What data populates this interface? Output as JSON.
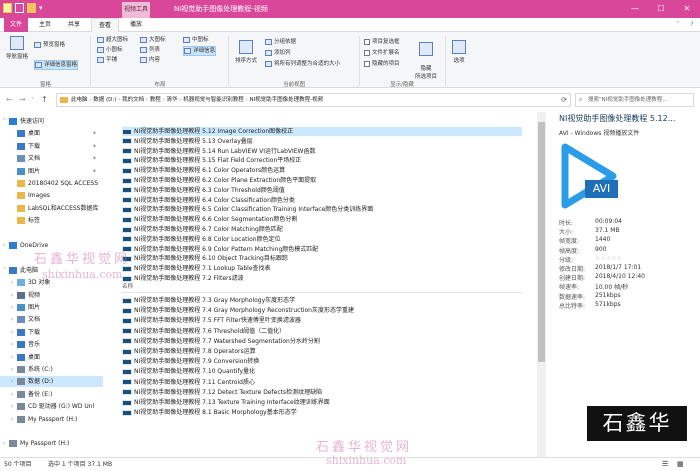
{
  "window": {
    "title": "NI视觉助手图像处理教程-视频",
    "context_tab": "视频工具",
    "controls": [
      "—",
      "☐",
      "✕"
    ]
  },
  "tabs": [
    {
      "label": "文件",
      "kind": "file"
    },
    {
      "label": "主页",
      "kind": "normal"
    },
    {
      "label": "共享",
      "kind": "normal"
    },
    {
      "label": "查看",
      "kind": "active"
    },
    {
      "label": "播放",
      "kind": "normal"
    }
  ],
  "ribbon": {
    "panes": {
      "nav_pane": "导航窗格",
      "preview": "预览窗格",
      "details": "详细信息窗格"
    },
    "layout": [
      "超大图标",
      "大图标",
      "中图标",
      "小图标",
      "列表",
      "详细信息",
      "平铺",
      "内容"
    ],
    "sort": "排序方式",
    "current_view": [
      "分组依据",
      "添加列",
      "将所有列调整为合适的大小"
    ],
    "show_hide": [
      "项目复选框",
      "文件扩展名",
      "隐藏的项目"
    ],
    "hide_selected": "隐藏\n所选项目",
    "options": "选项",
    "groups": {
      "panes": "窗格",
      "layout": "布局",
      "current_view": "当前视图",
      "show_hide": "显示/隐藏"
    }
  },
  "address": {
    "crumbs": [
      "此电脑",
      "数据 (D:)",
      "我的文档",
      "教程",
      "清华",
      "机器视觉与智能识别教程",
      "NI视觉助手图像处理教程-视频"
    ],
    "search_placeholder": "搜索\"NI视觉助手图像处理教程...",
    "back": "←",
    "forward": "→",
    "up": "↑",
    "recent": "˅",
    "refresh": "⟳"
  },
  "navpane": [
    {
      "label": "快速访问",
      "icon": "star-icon",
      "color": "#2b7cd3",
      "pin": false,
      "exp": "˅",
      "indent": 0
    },
    {
      "label": "桌面",
      "icon": "desktop-icon",
      "color": "#3a78c2",
      "pin": true,
      "exp": "",
      "indent": 1
    },
    {
      "label": "下载",
      "icon": "download-icon",
      "color": "#3a78c2",
      "pin": true,
      "exp": "",
      "indent": 1
    },
    {
      "label": "文档",
      "icon": "document-icon",
      "color": "#6b8fb8",
      "pin": true,
      "exp": "",
      "indent": 1
    },
    {
      "label": "图片",
      "icon": "picture-icon",
      "color": "#4a90c8",
      "pin": true,
      "exp": "",
      "indent": 1
    },
    {
      "label": "20180402 SQL ACCESS",
      "icon": "folder-icon",
      "color": "#e8b84a",
      "pin": false,
      "exp": "",
      "indent": 1
    },
    {
      "label": "Images",
      "icon": "folder-icon",
      "color": "#e8b84a",
      "pin": false,
      "exp": "",
      "indent": 1
    },
    {
      "label": "LabSQL和ACCESS数据库",
      "icon": "folder-icon",
      "color": "#e8b84a",
      "pin": false,
      "exp": "",
      "indent": 1
    },
    {
      "label": "标签",
      "icon": "folder-icon",
      "color": "#e8b84a",
      "pin": false,
      "exp": "",
      "indent": 1
    },
    {
      "label": "",
      "icon": "",
      "color": "",
      "pin": false,
      "exp": "",
      "indent": 0
    },
    {
      "label": "OneDrive",
      "icon": "cloud-icon",
      "color": "#2b7cd3",
      "pin": false,
      "exp": "›",
      "indent": 0
    },
    {
      "label": "",
      "icon": "",
      "color": "",
      "pin": false,
      "exp": "",
      "indent": 0
    },
    {
      "label": "此电脑",
      "icon": "computer-icon",
      "color": "#3a78c2",
      "pin": false,
      "exp": "˅",
      "indent": 0
    },
    {
      "label": "3D 对象",
      "icon": "cube-icon",
      "color": "#6fb0e0",
      "pin": false,
      "exp": "›",
      "indent": 1
    },
    {
      "label": "视频",
      "icon": "video-folder-icon",
      "color": "#5a6f8a",
      "pin": false,
      "exp": "›",
      "indent": 1
    },
    {
      "label": "图片",
      "icon": "picture-icon",
      "color": "#4a90c8",
      "pin": false,
      "exp": "›",
      "indent": 1
    },
    {
      "label": "文档",
      "icon": "document-icon",
      "color": "#6b8fb8",
      "pin": false,
      "exp": "›",
      "indent": 1
    },
    {
      "label": "下载",
      "icon": "download-icon",
      "color": "#3a78c2",
      "pin": false,
      "exp": "›",
      "indent": 1
    },
    {
      "label": "音乐",
      "icon": "music-icon",
      "color": "#3a78c2",
      "pin": false,
      "exp": "›",
      "indent": 1
    },
    {
      "label": "桌面",
      "icon": "desktop-icon",
      "color": "#3a78c2",
      "pin": false,
      "exp": "›",
      "indent": 1
    },
    {
      "label": "系统 (C:)",
      "icon": "drive-icon",
      "color": "#7a8a9a",
      "pin": false,
      "exp": "›",
      "indent": 1
    },
    {
      "label": "数据 (D:)",
      "icon": "drive-icon",
      "color": "#7a8a9a",
      "pin": false,
      "exp": "›",
      "indent": 1,
      "sel": true
    },
    {
      "label": "备份 (E:)",
      "icon": "drive-icon",
      "color": "#7a8a9a",
      "pin": false,
      "exp": "›",
      "indent": 1
    },
    {
      "label": "CD 驱动器 (G:) WD Unl",
      "icon": "cd-drive-icon",
      "color": "#7a8a9a",
      "pin": false,
      "exp": "›",
      "indent": 1
    },
    {
      "label": "My Passport (H:)",
      "icon": "drive-icon",
      "color": "#7a8a9a",
      "pin": false,
      "exp": "›",
      "indent": 1
    },
    {
      "label": "",
      "icon": "",
      "color": "",
      "pin": false,
      "exp": "",
      "indent": 0
    },
    {
      "label": "My Passport (H:)",
      "icon": "drive-icon",
      "color": "#7a8a9a",
      "pin": false,
      "exp": "›",
      "indent": 0
    }
  ],
  "files_top": [
    "NI视觉助手图像处理教程 5.12 Image Correction图像校正",
    "NI视觉助手图像处理教程 5.13 Overlay叠层",
    "NI视觉助手图像处理教程 5.14 Run LabVIEW VI运行LabVIEW函数",
    "NI视觉助手图像处理教程 5.15 Flat Field Correction平场校正",
    "NI视觉助手图像处理教程 6.1 Color Operators颜色运算",
    "NI视觉助手图像处理教程 6.2 Color Plane Extraction颜色平面提取",
    "NI视觉助手图像处理教程 6.3 Color Threshold颜色阈值",
    "NI视觉助手图像处理教程 6.4 Color Classification颜色分类",
    "NI视觉助手图像处理教程 6.5 Color Classification Training Interface颜色分类训练界面",
    "NI视觉助手图像处理教程 6.6 Color Segmentation颜色分割",
    "NI视觉助手图像处理教程 6.7 Color Matching颜色匹配",
    "NI视觉助手图像处理教程 6.8 Color Location颜色定位",
    "NI视觉助手图像处理教程 6.9 Color Pattern Matching颜色模式匹配",
    "NI视觉助手图像处理教程 6.10 Object Tracking目标跟踪",
    "NI视觉助手图像处理教程 7.1 Lookup Table查找表",
    "NI视觉助手图像处理教程 7.2 Filters滤波"
  ],
  "column_header": "名称",
  "files_bottom": [
    "NI视觉助手图像处理教程 7.3 Gray Morphology灰度形态学",
    "NI视觉助手图像处理教程 7.4 Gray Morphology Reconstruction灰度形态学重建",
    "NI视觉助手图像处理教程 7.5 FFT Filter快速傅里叶变换滤波器",
    "NI视觉助手图像处理教程 7.6 Threshold阈值（二值化）",
    "NI视觉助手图像处理教程 7.7 Watershed Segmentation分水岭分割",
    "NI视觉助手图像处理教程 7.8 Operators运算",
    "NI视觉助手图像处理教程 7.9 Conversion转换",
    "NI视觉助手图像处理教程 7.10 Quantify量化",
    "NI视觉助手图像处理教程 7.11 Centroid质心",
    "NI视觉助手图像处理教程 7.12 Detect Texture Defects检测纹理缺陷",
    "NI视觉助手图像处理教程 7.13 Texture Training Interface纹理训练界面",
    "NI视觉助手图像处理教程 8.1 Basic Morphology基本形态学"
  ],
  "preview": {
    "title": "NI视觉助手图像处理教程 5.12...",
    "subtitle": "AVI - Windows 视频播放文件",
    "badge": "AVI",
    "props": [
      {
        "label": "时长:",
        "value": "00:09:04"
      },
      {
        "label": "大小:",
        "value": "37.1 MB"
      },
      {
        "label": "帧宽度:",
        "value": "1440"
      },
      {
        "label": "帧高度:",
        "value": "900"
      },
      {
        "label": "分级:",
        "value": "☆☆☆☆☆"
      },
      {
        "label": "修改日期:",
        "value": "2018/1/7 17:01"
      },
      {
        "label": "创建日期:",
        "value": "2018/4/10 12:40"
      },
      {
        "label": "帧速率:",
        "value": "10.00 帧/秒"
      },
      {
        "label": "数据速率:",
        "value": "251kbps"
      },
      {
        "label": "总比特率:",
        "value": "571kbps"
      }
    ]
  },
  "status": {
    "count": "50 个项目",
    "selected": "选中 1 个项目 37.1 MB"
  },
  "watermark": {
    "cn": "石鑫华视觉网",
    "url": "shixinhua.com",
    "logo": "石鑫华"
  },
  "colors": {
    "accent": "#d9479a",
    "selection": "#cce8ff",
    "play": "#2b9de8"
  }
}
